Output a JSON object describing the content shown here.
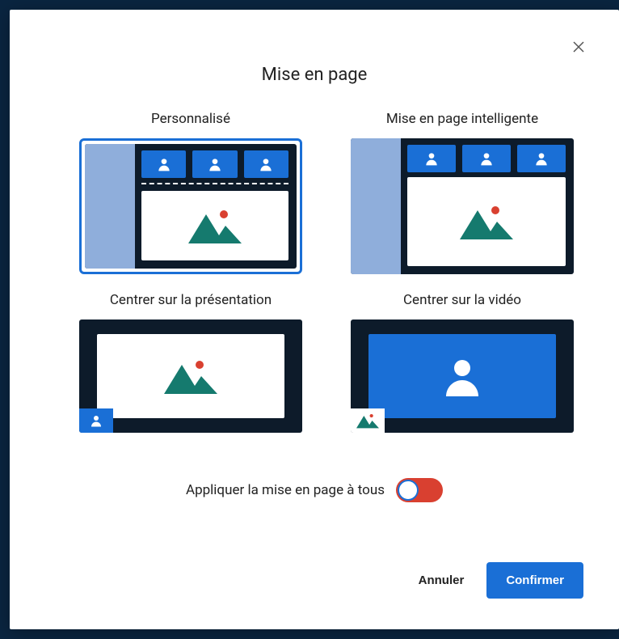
{
  "modal": {
    "title": "Mise en page",
    "options": [
      {
        "label": "Personnalisé",
        "selected": true
      },
      {
        "label": "Mise en page intelligente",
        "selected": false
      },
      {
        "label": "Centrer sur la présentation",
        "selected": false
      },
      {
        "label": "Centrer sur la vidéo",
        "selected": false
      }
    ],
    "toggle_label": "Appliquer la mise en page à tous",
    "toggle_on": false,
    "cancel_label": "Annuler",
    "confirm_label": "Confirmer"
  },
  "icons": {
    "close": "close-icon",
    "person": "person-icon",
    "mountain": "mountain-icon"
  },
  "colors": {
    "accent": "#1a6fd6",
    "danger": "#d94030",
    "teal": "#157a6e",
    "dark": "#0d1b2a",
    "sidebar": "#8faedb"
  }
}
